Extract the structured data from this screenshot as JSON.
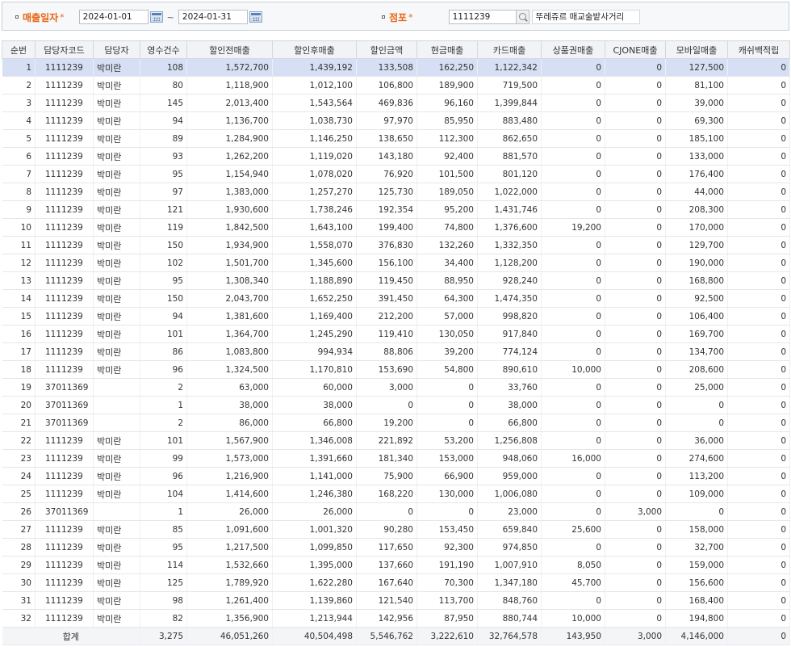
{
  "search": {
    "sale_date_label": "매출일자",
    "required_mark": "*",
    "date_from": "2024-01-01",
    "date_sep": "~",
    "date_to": "2024-01-31",
    "store_label": "점포",
    "store_code": "1111239",
    "store_name": "뚜레쥬르 매교술밭사거리"
  },
  "columns": [
    "순번",
    "담당자코드",
    "담당자",
    "영수건수",
    "할인전매출",
    "할인후매출",
    "할인금액",
    "현금매출",
    "카드매출",
    "상품권매출",
    "CJONE매출",
    "모바일매출",
    "캐쉬백적립"
  ],
  "rows": [
    [
      "1",
      "1111239",
      "박미란",
      "108",
      "1,572,700",
      "1,439,192",
      "133,508",
      "162,250",
      "1,122,342",
      "0",
      "0",
      "127,500",
      "0"
    ],
    [
      "2",
      "1111239",
      "박미란",
      "80",
      "1,118,900",
      "1,012,100",
      "106,800",
      "189,900",
      "719,500",
      "0",
      "0",
      "81,100",
      "0"
    ],
    [
      "3",
      "1111239",
      "박미란",
      "145",
      "2,013,400",
      "1,543,564",
      "469,836",
      "96,160",
      "1,399,844",
      "0",
      "0",
      "39,000",
      "0"
    ],
    [
      "4",
      "1111239",
      "박미란",
      "94",
      "1,136,700",
      "1,038,730",
      "97,970",
      "85,950",
      "883,480",
      "0",
      "0",
      "69,300",
      "0"
    ],
    [
      "5",
      "1111239",
      "박미란",
      "89",
      "1,284,900",
      "1,146,250",
      "138,650",
      "112,300",
      "862,650",
      "0",
      "0",
      "185,100",
      "0"
    ],
    [
      "6",
      "1111239",
      "박미란",
      "93",
      "1,262,200",
      "1,119,020",
      "143,180",
      "92,400",
      "881,570",
      "0",
      "0",
      "133,000",
      "0"
    ],
    [
      "7",
      "1111239",
      "박미란",
      "95",
      "1,154,940",
      "1,078,020",
      "76,920",
      "101,500",
      "801,120",
      "0",
      "0",
      "176,400",
      "0"
    ],
    [
      "8",
      "1111239",
      "박미란",
      "97",
      "1,383,000",
      "1,257,270",
      "125,730",
      "189,050",
      "1,022,000",
      "0",
      "0",
      "44,000",
      "0"
    ],
    [
      "9",
      "1111239",
      "박미란",
      "121",
      "1,930,600",
      "1,738,246",
      "192,354",
      "95,200",
      "1,431,746",
      "0",
      "0",
      "208,300",
      "0"
    ],
    [
      "10",
      "1111239",
      "박미란",
      "119",
      "1,842,500",
      "1,643,100",
      "199,400",
      "74,800",
      "1,376,600",
      "19,200",
      "0",
      "170,000",
      "0"
    ],
    [
      "11",
      "1111239",
      "박미란",
      "150",
      "1,934,900",
      "1,558,070",
      "376,830",
      "132,260",
      "1,332,350",
      "0",
      "0",
      "129,700",
      "0"
    ],
    [
      "12",
      "1111239",
      "박미란",
      "102",
      "1,501,700",
      "1,345,600",
      "156,100",
      "34,400",
      "1,128,200",
      "0",
      "0",
      "190,000",
      "0"
    ],
    [
      "13",
      "1111239",
      "박미란",
      "95",
      "1,308,340",
      "1,188,890",
      "119,450",
      "88,950",
      "928,240",
      "0",
      "0",
      "168,800",
      "0"
    ],
    [
      "14",
      "1111239",
      "박미란",
      "150",
      "2,043,700",
      "1,652,250",
      "391,450",
      "64,300",
      "1,474,350",
      "0",
      "0",
      "92,500",
      "0"
    ],
    [
      "15",
      "1111239",
      "박미란",
      "94",
      "1,381,600",
      "1,169,400",
      "212,200",
      "57,000",
      "998,820",
      "0",
      "0",
      "106,400",
      "0"
    ],
    [
      "16",
      "1111239",
      "박미란",
      "101",
      "1,364,700",
      "1,245,290",
      "119,410",
      "130,050",
      "917,840",
      "0",
      "0",
      "169,700",
      "0"
    ],
    [
      "17",
      "1111239",
      "박미란",
      "86",
      "1,083,800",
      "994,934",
      "88,806",
      "39,200",
      "774,124",
      "0",
      "0",
      "134,700",
      "0"
    ],
    [
      "18",
      "1111239",
      "박미란",
      "96",
      "1,324,500",
      "1,170,810",
      "153,690",
      "54,800",
      "890,610",
      "10,000",
      "0",
      "208,600",
      "0"
    ],
    [
      "19",
      "37011369",
      "",
      "2",
      "63,000",
      "60,000",
      "3,000",
      "0",
      "33,760",
      "0",
      "0",
      "25,000",
      "0"
    ],
    [
      "20",
      "37011369",
      "",
      "1",
      "38,000",
      "38,000",
      "0",
      "0",
      "38,000",
      "0",
      "0",
      "0",
      "0"
    ],
    [
      "21",
      "37011369",
      "",
      "2",
      "86,000",
      "66,800",
      "19,200",
      "0",
      "66,800",
      "0",
      "0",
      "0",
      "0"
    ],
    [
      "22",
      "1111239",
      "박미란",
      "101",
      "1,567,900",
      "1,346,008",
      "221,892",
      "53,200",
      "1,256,808",
      "0",
      "0",
      "36,000",
      "0"
    ],
    [
      "23",
      "1111239",
      "박미란",
      "99",
      "1,573,000",
      "1,391,660",
      "181,340",
      "153,000",
      "948,060",
      "16,000",
      "0",
      "274,600",
      "0"
    ],
    [
      "24",
      "1111239",
      "박미란",
      "96",
      "1,216,900",
      "1,141,000",
      "75,900",
      "66,900",
      "959,000",
      "0",
      "0",
      "113,200",
      "0"
    ],
    [
      "25",
      "1111239",
      "박미란",
      "104",
      "1,414,600",
      "1,246,380",
      "168,220",
      "130,000",
      "1,006,080",
      "0",
      "0",
      "109,000",
      "0"
    ],
    [
      "26",
      "37011369",
      "",
      "1",
      "26,000",
      "26,000",
      "0",
      "0",
      "23,000",
      "0",
      "3,000",
      "0",
      "0"
    ],
    [
      "27",
      "1111239",
      "박미란",
      "85",
      "1,091,600",
      "1,001,320",
      "90,280",
      "153,450",
      "659,840",
      "25,600",
      "0",
      "158,000",
      "0"
    ],
    [
      "28",
      "1111239",
      "박미란",
      "95",
      "1,217,500",
      "1,099,850",
      "117,650",
      "92,300",
      "974,850",
      "0",
      "0",
      "32,700",
      "0"
    ],
    [
      "29",
      "1111239",
      "박미란",
      "114",
      "1,532,660",
      "1,395,000",
      "137,660",
      "191,190",
      "1,007,910",
      "8,050",
      "0",
      "159,000",
      "0"
    ],
    [
      "30",
      "1111239",
      "박미란",
      "125",
      "1,789,920",
      "1,622,280",
      "167,640",
      "70,300",
      "1,347,180",
      "45,700",
      "0",
      "156,600",
      "0"
    ],
    [
      "31",
      "1111239",
      "박미란",
      "98",
      "1,261,400",
      "1,139,860",
      "121,540",
      "113,700",
      "848,760",
      "0",
      "0",
      "168,400",
      "0"
    ],
    [
      "32",
      "1111239",
      "박미란",
      "82",
      "1,356,900",
      "1,213,944",
      "142,956",
      "87,950",
      "880,744",
      "10,000",
      "0",
      "194,800",
      "0"
    ]
  ],
  "totals": {
    "label": "합계",
    "values": [
      "3,275",
      "46,051,260",
      "40,504,498",
      "5,546,762",
      "3,222,610",
      "32,764,578",
      "143,950",
      "3,000",
      "4,146,000",
      "0"
    ]
  },
  "selected_row_index": 0
}
